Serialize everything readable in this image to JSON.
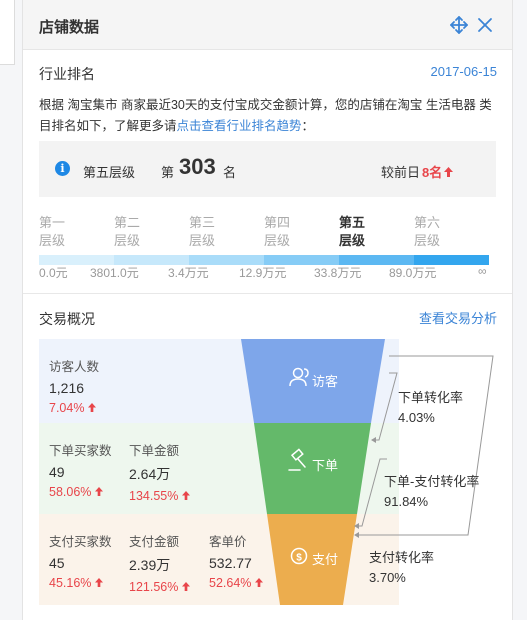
{
  "header": {
    "title": "店铺数据"
  },
  "industry": {
    "title": "行业排名",
    "date": "2017-06-15",
    "desc_prefix": "根据 淘宝集市 商家最近30天的支付宝成交金额计算，您的店铺在淘宝 生活电器 类目排名如下，了解更多请",
    "desc_link": "点击查看行业排名趋势",
    "desc_suffix": "：",
    "rank": {
      "level": "第五层级",
      "prefix": "第",
      "number": "303",
      "suffix": "名",
      "compare_label": "较前日",
      "change": "8名",
      "change_direction": "up"
    },
    "levels": [
      {
        "line1": "第一",
        "line2": "层级",
        "active": false
      },
      {
        "line1": "第二",
        "line2": "层级",
        "active": false
      },
      {
        "line1": "第三",
        "line2": "层级",
        "active": false
      },
      {
        "line1": "第四",
        "line2": "层级",
        "active": false
      },
      {
        "line1": "第五",
        "line2": "层级",
        "active": true
      },
      {
        "line1": "第六",
        "line2": "层级",
        "active": false
      }
    ],
    "thresholds": [
      "0.0元",
      "3801.0元",
      "3.4万元",
      "12.9万元",
      "33.8万元",
      "89.0万元",
      "∞"
    ],
    "bar_colors": [
      "#d9f0fc",
      "#c6e8fb",
      "#a9dcf9",
      "#86ccf6",
      "#5cb8f2",
      "#33a6ee"
    ]
  },
  "trade": {
    "title": "交易概况",
    "link": "查看交易分析",
    "visitors": {
      "label": "访客人数",
      "value": "1,216",
      "change": "7.04%"
    },
    "buyers": {
      "label": "下单买家数",
      "value": "49",
      "change": "58.06%"
    },
    "order_amount": {
      "label": "下单金额",
      "value": "2.64万",
      "change": "134.55%"
    },
    "pay_buyers": {
      "label": "支付买家数",
      "value": "45",
      "change": "45.16%"
    },
    "pay_amount": {
      "label": "支付金额",
      "value": "2.39万",
      "change": "121.56%"
    },
    "avg_price": {
      "label": "客单价",
      "value": "532.77",
      "change": "52.64%"
    },
    "funnel": {
      "visit": {
        "label": "访客",
        "color": "#7ea6ea"
      },
      "order": {
        "label": "下单",
        "color": "#64b96a"
      },
      "pay": {
        "label": "支付",
        "color": "#ecad4e"
      }
    },
    "rates": {
      "order": {
        "label": "下单转化率",
        "value": "4.03%"
      },
      "order_pay": {
        "label": "下单-支付转化率",
        "value": "91.84%"
      },
      "pay": {
        "label": "支付转化率",
        "value": "3.70%"
      }
    }
  }
}
